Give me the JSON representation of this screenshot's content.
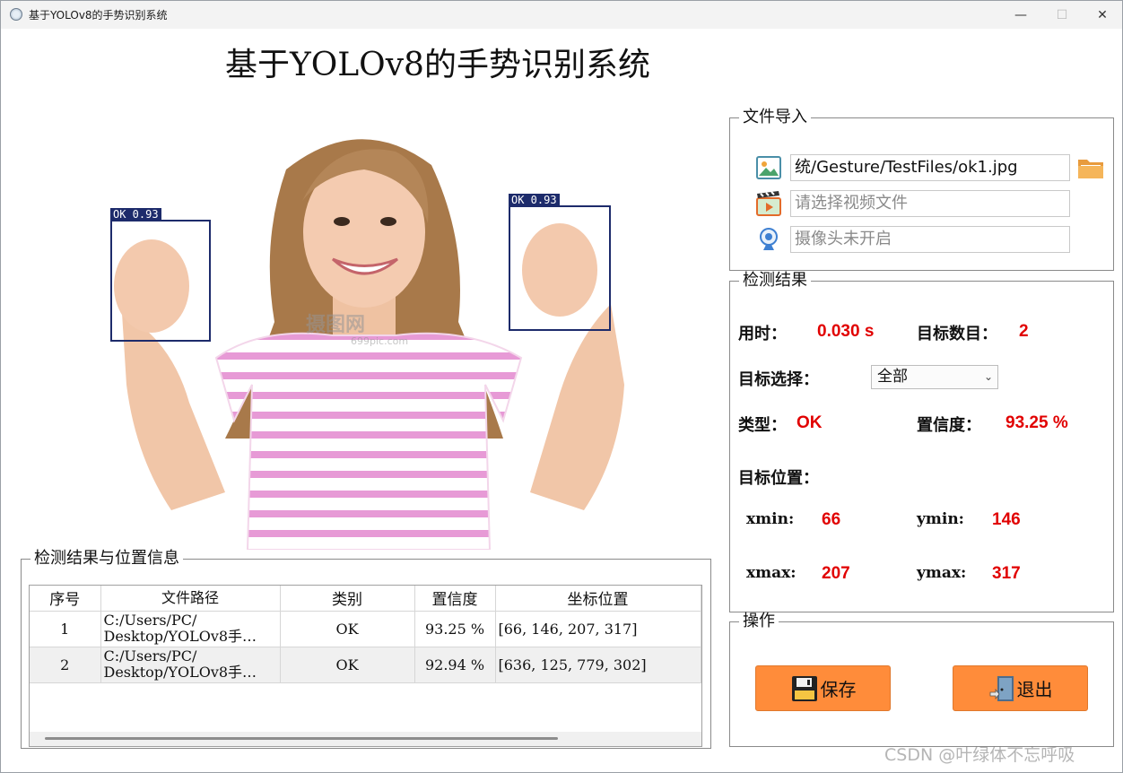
{
  "window": {
    "title": "基于YOLOv8的手势识别系统",
    "min_glyph": "—",
    "max_glyph": "☐",
    "close_glyph": "✕"
  },
  "header": {
    "title": "基于YOLOv8的手势识别系统"
  },
  "preview": {
    "detections": [
      {
        "label": "OK 0.93"
      },
      {
        "label": "OK 0.93"
      }
    ],
    "watermark": "摄图网",
    "watermark_sub": "699pic.com"
  },
  "file_import": {
    "title": "文件导入",
    "image_path": "统/Gesture/TestFiles/ok1.jpg",
    "video_placeholder": "请选择视频文件",
    "camera_placeholder": "摄像头未开启",
    "icons": [
      "image-icon",
      "video-icon",
      "camera-icon",
      "folder-icon"
    ]
  },
  "result": {
    "title": "检测结果",
    "time_label": "用时：",
    "time_value": "0.030 s",
    "count_label": "目标数目：",
    "count_value": "2",
    "select_label": "目标选择：",
    "select_value": "全部",
    "type_label": "类型：",
    "type_value": "OK",
    "conf_label": "置信度：",
    "conf_value": "93.25 %",
    "pos_label": "目标位置：",
    "xmin_label": "xmin:",
    "xmin_value": "66",
    "ymin_label": "ymin:",
    "ymin_value": "146",
    "xmax_label": "xmax:",
    "xmax_value": "207",
    "ymax_label": "ymax:",
    "ymax_value": "317"
  },
  "actions": {
    "title": "操作",
    "save_label": "保存",
    "exit_label": "退出"
  },
  "table_section": {
    "title": "检测结果与位置信息",
    "columns": [
      "序号",
      "文件路径",
      "类别",
      "置信度",
      "坐标位置"
    ],
    "rows": [
      {
        "idx": "1",
        "path1": "C:/Users/PC/",
        "path2": "Desktop/YOLOv8手…",
        "cls": "OK",
        "conf": "93.25 %",
        "pos": "[66, 146, 207, 317]"
      },
      {
        "idx": "2",
        "path1": "C:/Users/PC/",
        "path2": "Desktop/YOLOv8手…",
        "cls": "OK",
        "conf": "92.94 %",
        "pos": "[636, 125, 779, 302]"
      }
    ]
  },
  "footer_watermark": "CSDN @叶绿体不忘呼吸",
  "colors": {
    "accent_button": "#ff8c3a",
    "value_red": "#e10000",
    "bbox": "#1d2b6b"
  }
}
